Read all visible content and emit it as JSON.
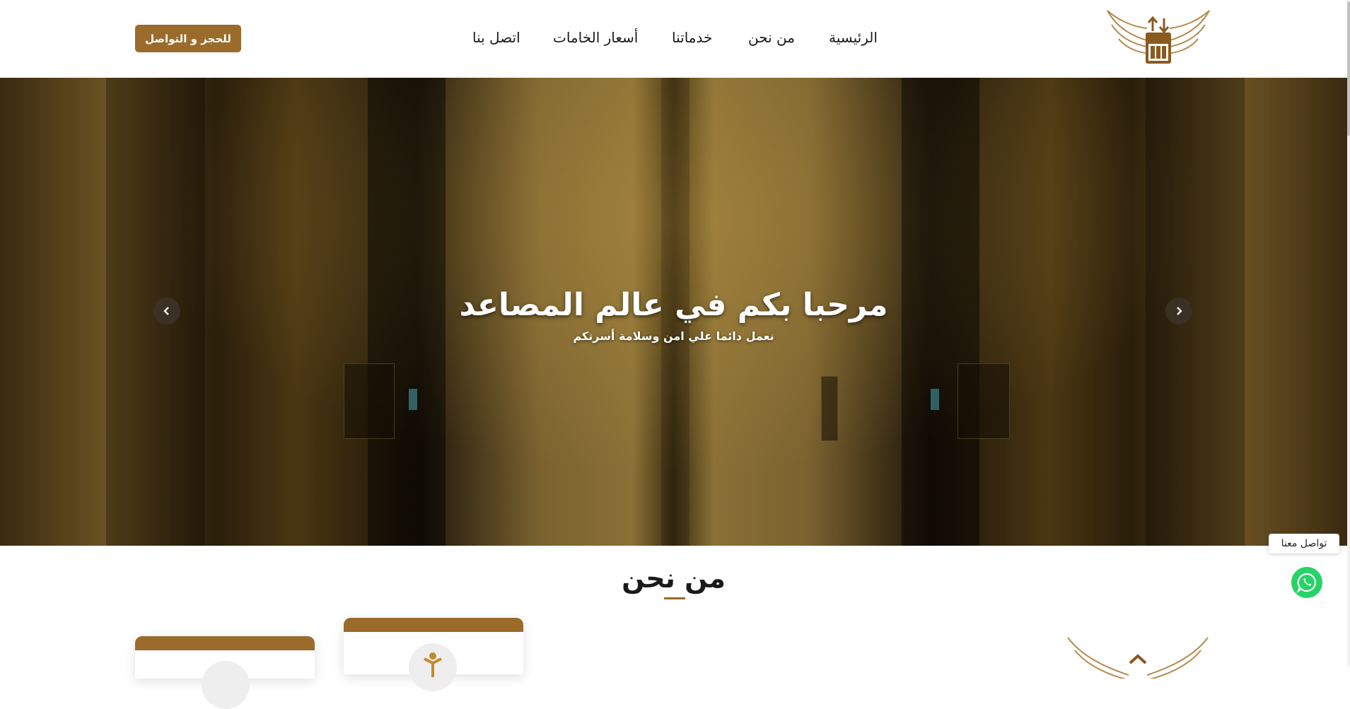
{
  "nav": {
    "items": [
      {
        "label": "الرئيسية"
      },
      {
        "label": "من نحن"
      },
      {
        "label": "خدماتنا"
      },
      {
        "label": "أسعار الخامات"
      },
      {
        "label": "اتصل بنا"
      }
    ],
    "cta_label": "للحجز و التواصل"
  },
  "hero": {
    "title": "مرحبا بكم في عالم المصاعد",
    "subtitle": "نعمل دائما علي امن وسلامة أسرتكم"
  },
  "about": {
    "title": "من نحن"
  },
  "whatsapp": {
    "label": "تواصل معنا"
  },
  "colors": {
    "brand": "#9a6b2a",
    "whatsapp": "#25d366"
  },
  "icons": [
    "logo-wings-elevator",
    "chevron-left-icon",
    "chevron-right-icon",
    "whatsapp-icon",
    "person-icon"
  ]
}
